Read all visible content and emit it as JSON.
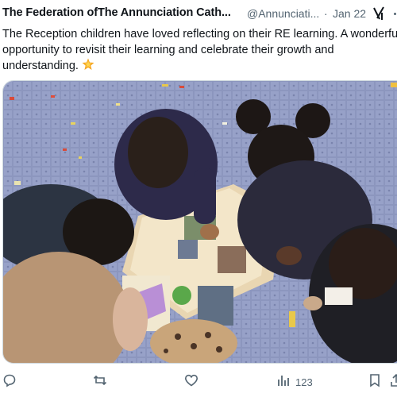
{
  "tweet": {
    "author_name": "The Federation ofThe Annunciation Cath...",
    "handle": "@Annunciati...",
    "separator": "·",
    "date": "Jan 22",
    "text_lines": [
      "The Reception children have loved reflecting on their RE learning. A wonderful",
      "opportunity to revisit their learning and celebrate their growth and",
      "understanding."
    ],
    "emoji_icon": "glowing-star-icon",
    "media_alt": "Children on a classroom carpet looking at a large open book"
  },
  "actions": {
    "reply_icon": "reply-icon",
    "retweet_icon": "retweet-icon",
    "like_icon": "heart-icon",
    "views_icon": "views-bar-icon",
    "views_count": "123",
    "bookmark_icon": "bookmark-icon",
    "share_icon": "share-icon"
  },
  "colors": {
    "text": "#0f1419",
    "secondary": "#536471",
    "border": "#cfd9de",
    "carpet": "#8d97bf"
  }
}
